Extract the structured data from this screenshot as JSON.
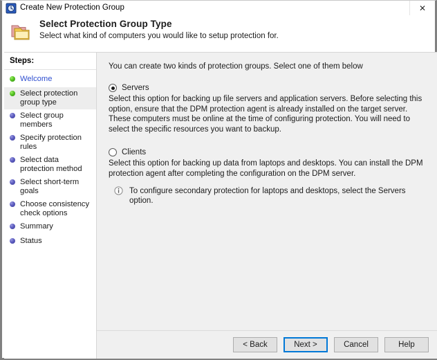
{
  "window": {
    "title": "Create New Protection Group",
    "icon": "dpm-clock-icon",
    "close_label": "✕"
  },
  "header": {
    "icon": "folders-icon",
    "title": "Select Protection Group Type",
    "subtitle": "Select what kind of computers you would like to setup protection for."
  },
  "sidebar": {
    "label": "Steps:",
    "items": [
      {
        "label": "Welcome",
        "state": "green",
        "link": true,
        "active": false
      },
      {
        "label": "Select protection group type",
        "state": "green",
        "link": false,
        "active": true
      },
      {
        "label": "Select group members",
        "state": "purple",
        "link": false,
        "active": false
      },
      {
        "label": "Specify protection rules",
        "state": "purple",
        "link": false,
        "active": false
      },
      {
        "label": "Select data protection method",
        "state": "purple",
        "link": false,
        "active": false
      },
      {
        "label": "Select short-term goals",
        "state": "purple",
        "link": false,
        "active": false
      },
      {
        "label": "Choose consistency check options",
        "state": "purple",
        "link": false,
        "active": false
      },
      {
        "label": "Summary",
        "state": "purple",
        "link": false,
        "active": false
      },
      {
        "label": "Status",
        "state": "purple",
        "link": false,
        "active": false
      }
    ]
  },
  "main": {
    "intro": "You can create two kinds of protection groups. Select one of them below",
    "options": [
      {
        "label": "Servers",
        "selected": true,
        "description": "Select this option for backing up file servers and application servers. Before selecting this option, ensure that the DPM protection agent is already installed on the target server. These computers must be online at the time of configuring protection. You will need to select the specific resources you want to backup."
      },
      {
        "label": "Clients",
        "selected": false,
        "description": "Select this option for backing up data from laptops and desktops. You can install the DPM protection agent after completing the configuration on the DPM server."
      }
    ],
    "note": {
      "icon": "info-icon",
      "text": "To configure secondary protection for laptops and desktops, select the Servers option."
    }
  },
  "footer": {
    "buttons": [
      {
        "label": "< Back",
        "default": false
      },
      {
        "label": "Next >",
        "default": true
      },
      {
        "label": "Cancel",
        "default": false
      },
      {
        "label": "Help",
        "default": false
      }
    ]
  },
  "colors": {
    "accent": "#0078d7",
    "link": "#2f4fd0",
    "panel": "#f0f0f0",
    "frame": "#808080"
  }
}
